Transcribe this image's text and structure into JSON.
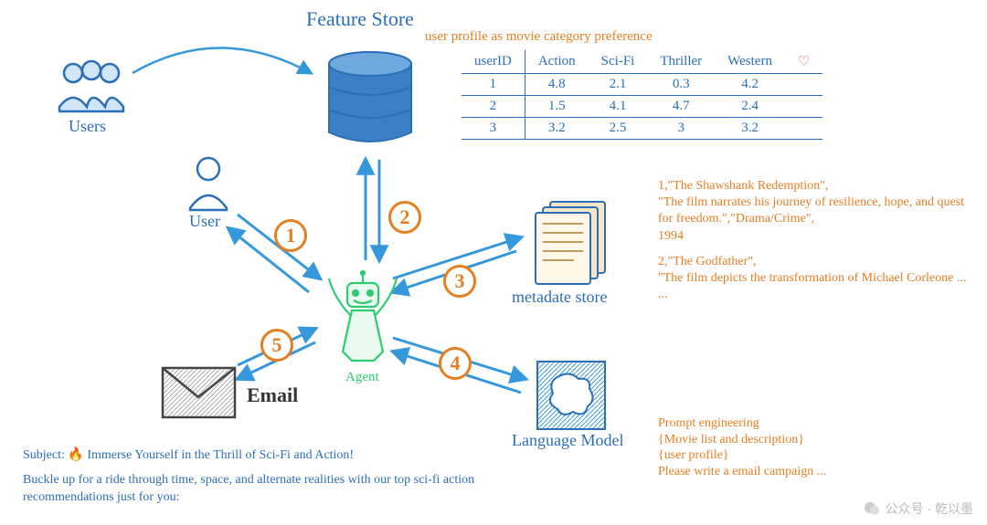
{
  "title": "Feature Store",
  "subtitle": "user profile as movie category preference",
  "labels": {
    "users": "Users",
    "user": "User",
    "agent": "Agent",
    "email": "Email",
    "metadata_store": "metadate store",
    "language_model": "Language Model"
  },
  "steps": [
    "1",
    "2",
    "3",
    "4",
    "5"
  ],
  "table": {
    "headers": [
      "userID",
      "Action",
      "Sci-Fi",
      "Thriller",
      "Western"
    ],
    "heart": "♡",
    "rows": [
      [
        "1",
        "4.8",
        "2.1",
        "0.3",
        "4.2"
      ],
      [
        "2",
        "1.5",
        "4.1",
        "4.7",
        "2.4"
      ],
      [
        "3",
        "3.2",
        "2.5",
        "3",
        "3.2"
      ]
    ]
  },
  "metadata": {
    "line1": "1,\"The Shawshank Redemption\",",
    "line2": "\"The film narrates his journey of resilience, hope, and quest for freedom.\",\"Drama/Crime\",",
    "line3": "1994",
    "line4": "2,\"The Godfather\",",
    "line5": "\"The film depicts the transformation of Michael Corleone ... ..."
  },
  "prompt": {
    "l1": "Prompt engineering",
    "l2": "{Movie list and description}",
    "l3": "{user profile}",
    "l4": "Please write a email campaign ..."
  },
  "email": {
    "subject_prefix": "Subject: ",
    "fire": "🔥",
    "subject": "  Immerse Yourself in the Thrill of Sci-Fi and Action!",
    "body": "Buckle up for a ride through time, space, and alternate realities with our top sci-fi action recommendations just for you:"
  },
  "watermark": "公众号 · 乾以墨"
}
